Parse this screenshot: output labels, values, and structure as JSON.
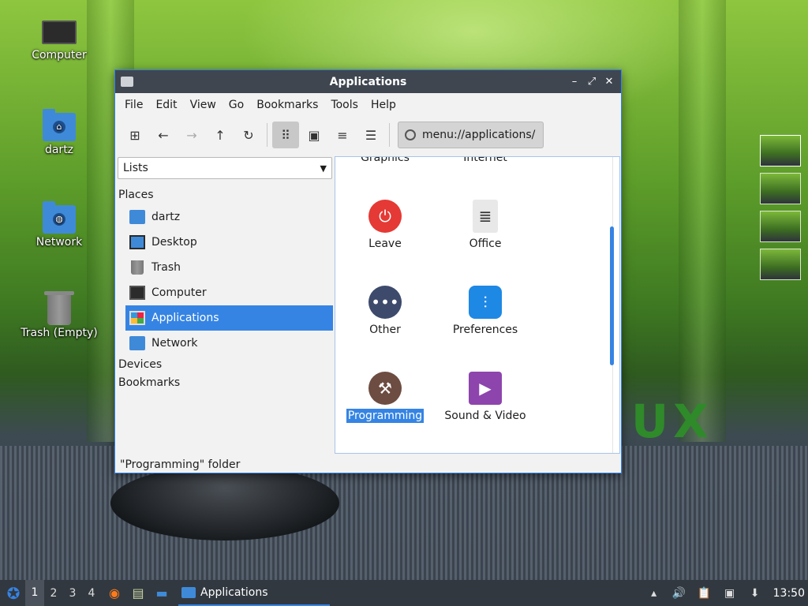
{
  "desktop": {
    "icons": [
      {
        "label": "Computer",
        "icon": "computer-icon"
      },
      {
        "label": "dartz",
        "icon": "home-folder-icon"
      },
      {
        "label": "Network",
        "icon": "network-folder-icon"
      },
      {
        "label": "Trash (Empty)",
        "icon": "trash-icon"
      }
    ],
    "wallpaper_text": "UX"
  },
  "window": {
    "title": "Applications",
    "controls": {
      "minimize": "–",
      "maximize": "⤢",
      "close": "✕"
    },
    "menu": [
      "File",
      "Edit",
      "View",
      "Go",
      "Bookmarks",
      "Tools",
      "Help"
    ],
    "toolbar": {
      "new_tab": "⊞",
      "back": "←",
      "forward": "→",
      "up": "↑",
      "reload": "↻",
      "icon_view": "⠿",
      "thumbnail_view": "▣",
      "compact_view": "≡",
      "detail_view": "☰"
    },
    "location": "menu://applications/",
    "side_pane": {
      "mode": "Lists",
      "sections": {
        "places": "Places",
        "devices": "Devices",
        "bookmarks": "Bookmarks"
      },
      "places": [
        {
          "label": "dartz",
          "icon": "home-folder-icon"
        },
        {
          "label": "Desktop",
          "icon": "desktop-icon"
        },
        {
          "label": "Trash",
          "icon": "trash-icon"
        },
        {
          "label": "Computer",
          "icon": "computer-icon"
        },
        {
          "label": "Applications",
          "icon": "applications-icon",
          "selected": true
        },
        {
          "label": "Network",
          "icon": "network-icon"
        }
      ]
    },
    "folder_items": {
      "partial": [
        "Graphics",
        "Internet"
      ],
      "items": [
        {
          "label": "Leave",
          "icon": "power-icon",
          "color": "#e53935"
        },
        {
          "label": "Office",
          "icon": "document-icon",
          "color": "#e8e8e8"
        },
        {
          "label": "Other",
          "icon": "more-icon",
          "color": "#3d4a6b"
        },
        {
          "label": "Preferences",
          "icon": "sliders-icon",
          "color": "#1e88e5"
        },
        {
          "label": "Programming",
          "icon": "hammer-icon",
          "color": "#6d4c41",
          "selected": true
        },
        {
          "label": "Sound & Video",
          "icon": "multimedia-icon",
          "color": "#8e44ad"
        }
      ]
    },
    "status": "\"Programming\" folder"
  },
  "taskbar": {
    "workspaces": [
      "1",
      "2",
      "3",
      "4"
    ],
    "active_workspace": "1",
    "task_title": "Applications",
    "clock": "13:50"
  },
  "colors": {
    "accent": "#3584e4",
    "titlebar": "#3f4650",
    "taskbar": "#323840"
  }
}
